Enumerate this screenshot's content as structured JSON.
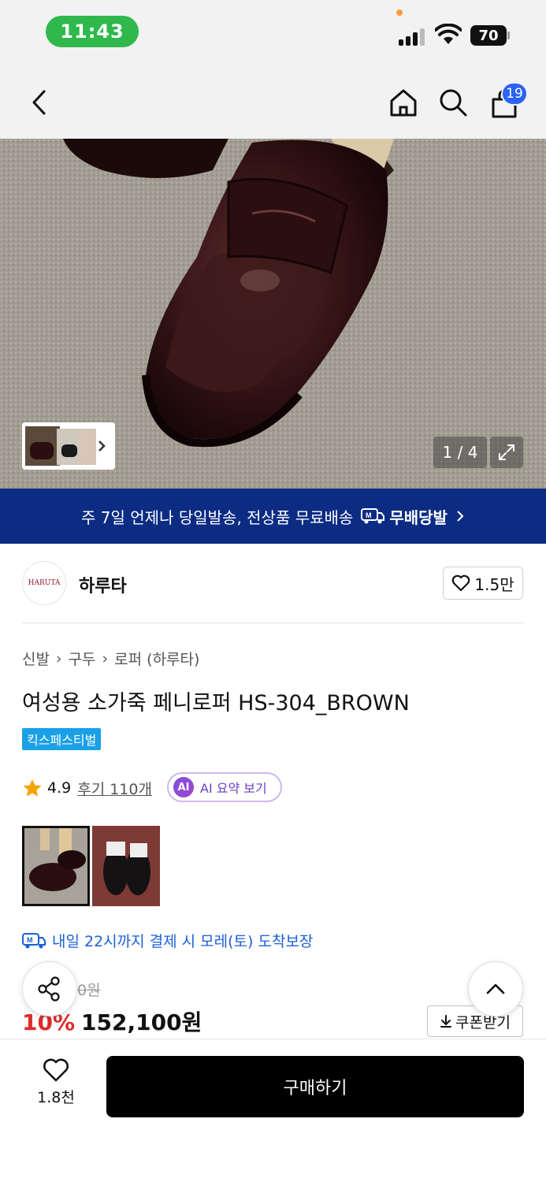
{
  "status": {
    "time": "11:43",
    "battery": "70"
  },
  "header": {
    "cart_count": "19"
  },
  "gallery": {
    "counter": "1 / 4"
  },
  "banner": {
    "text": "주 7일 언제나 당일발송, 전상품 무료배송",
    "brand": "무배당발",
    "brand_icon": "truck-m-icon"
  },
  "store": {
    "logo_text": "HARUTA",
    "name": "하루타",
    "likes": "1.5만"
  },
  "breadcrumb": [
    "신발",
    "구두",
    "로퍼 (하루타)"
  ],
  "product": {
    "title": "여성용 소가죽 페니로퍼 HS-304_BROWN",
    "tag": "킥스페스티벌",
    "rating": "4.9",
    "review_link": "후기 110개",
    "ai_badge": "AI",
    "ai_label": "AI 요약 보기",
    "delivery": "내일 22시까지 결제 시 모레(토) 도착보장",
    "original_price_visible": "0원",
    "discount": "10%",
    "price": "152,100원",
    "coupon": "쿠폰받기"
  },
  "bottom": {
    "wish_count": "1.8천",
    "buy_label": "구매하기"
  },
  "colors": {
    "accent_blue": "#2a63f5",
    "banner_navy": "#0c2c84",
    "discount_red": "#e02a2a",
    "tag_blue": "#1aa0e6",
    "delivery_blue": "#1a5fd8"
  }
}
